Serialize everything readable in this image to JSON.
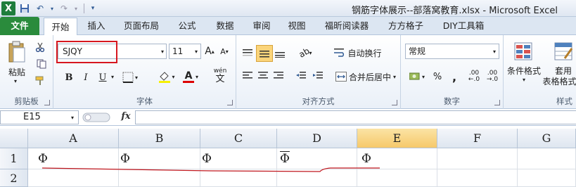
{
  "window": {
    "title": "钢筋字体展示--部落窝教育.xlsx  -  Microsoft Excel"
  },
  "qat": {
    "logo": "X"
  },
  "tabs": [
    {
      "label": "文件"
    },
    {
      "label": "开始"
    },
    {
      "label": "插入"
    },
    {
      "label": "页面布局"
    },
    {
      "label": "公式"
    },
    {
      "label": "数据"
    },
    {
      "label": "审阅"
    },
    {
      "label": "视图"
    },
    {
      "label": "福昕阅读器"
    },
    {
      "label": "方方格子"
    },
    {
      "label": "DIY工具箱"
    }
  ],
  "ribbon": {
    "clipboard": {
      "paste_label": "粘贴",
      "group_label": "剪贴板"
    },
    "font": {
      "font_name": "SJQY",
      "font_size": "11",
      "bold": "B",
      "italic": "I",
      "underline": "U",
      "wen": "wén",
      "wen2": "文",
      "font_color_letter": "A",
      "group_label": "字体"
    },
    "alignment": {
      "wrap_label": "自动换行",
      "merge_label": "合并后居中",
      "group_label": "对齐方式"
    },
    "number": {
      "format": "常规",
      "percent": "%",
      "comma": ",",
      "inc": ".00",
      "group_label": "数字"
    },
    "styles": {
      "cond_label": "条件格式",
      "table_label1": "套用",
      "table_label2": "表格格式",
      "group_label": "样式"
    }
  },
  "formula_bar": {
    "name_box": "E15",
    "fx": "fx",
    "value": ""
  },
  "sheet": {
    "columns": [
      "A",
      "B",
      "C",
      "D",
      "E",
      "F",
      "G"
    ],
    "rows": [
      "1",
      "2"
    ],
    "cells_row1": [
      "Φ",
      "Φ",
      "Φ",
      "Φ",
      "Φ",
      "",
      ""
    ]
  },
  "colors": {
    "file_tab": "#2a8b3c",
    "highlight_box": "#d7171f",
    "selected_col": "#f6c96a",
    "annotation_line": "#c0181f"
  }
}
